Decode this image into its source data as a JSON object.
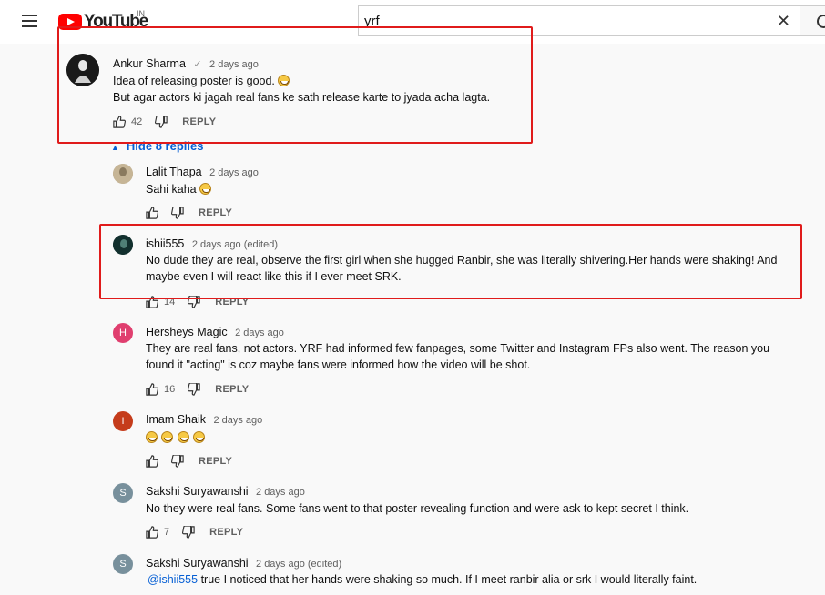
{
  "header": {
    "logo_text": "YouTube",
    "country": "IN",
    "search_value": "yrf",
    "clear_symbol": "✕"
  },
  "comments": [
    {
      "author": "Ankur Sharma",
      "verified_symbol": "✓",
      "time": "2 days ago",
      "line1": "Idea of releasing poster is good.",
      "line2": "But agar actors ki jagah real fans ke sath release karte to jyada acha lagta.",
      "likes": "42",
      "reply": "REPLY"
    }
  ],
  "hide_replies": "Hide 8 replies",
  "replies": [
    {
      "author": "Lalit Thapa",
      "time": "2 days ago",
      "text": "Sahi kaha",
      "likes": "",
      "reply": "REPLY",
      "avatar_color": "#b7a68a"
    },
    {
      "author": "ishii555",
      "time": "2 days ago (edited)",
      "text": "No dude they are real, observe the first girl when she hugged Ranbir, she was literally shivering.Her hands were shaking! And maybe even I will react like this if I ever meet SRK.",
      "likes": "14",
      "reply": "REPLY",
      "avatar_color": "#1f3a3a"
    },
    {
      "author": "Hersheys Magic",
      "time": "2 days ago",
      "text": "They are real fans, not actors. YRF had informed few fanpages, some Twitter and Instagram FPs also went. The reason you found it \"acting\" is coz maybe fans were informed how the video will be shot.",
      "likes": "16",
      "reply": "REPLY",
      "avatar_letter": "H",
      "avatar_color": "#e03f6f"
    },
    {
      "author": "Imam Shaik",
      "time": "2 days ago",
      "text": "",
      "likes": "",
      "reply": "REPLY",
      "avatar_letter": "I",
      "avatar_color": "#c53c1b"
    },
    {
      "author": "Sakshi Suryawanshi",
      "time": "2 days ago",
      "text": "No they were real fans. Some fans went to that poster revealing function and were ask to kept secret I think.",
      "likes": "7",
      "reply": "REPLY",
      "avatar_letter": "S",
      "avatar_color": "#78909c"
    },
    {
      "author": "Sakshi Suryawanshi",
      "time": "2 days ago (edited)",
      "mention": "@ishii555",
      "text": "true I noticed that her hands were shaking so much. If I meet ranbir alia or srk I would literally faint.",
      "avatar_letter": "S",
      "avatar_color": "#78909c"
    }
  ],
  "colors": {
    "highlight_box": "#e01b1b",
    "link_blue": "#065fd4",
    "logo_red": "#ff0000"
  },
  "icons": [
    "hamburger-menu-icon",
    "youtube-logo-icon",
    "clear-search-icon",
    "search-icon",
    "thumbs-up-icon",
    "thumbs-down-icon",
    "caret-up-icon",
    "grinning-emoji-icon",
    "rofl-emoji-icon"
  ]
}
